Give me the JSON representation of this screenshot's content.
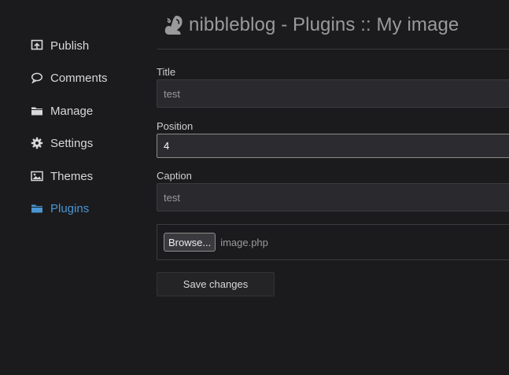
{
  "header": {
    "logo_icon": "squirrel-logo-icon",
    "title": "nibbleblog - Plugins :: My image"
  },
  "sidebar": {
    "items": [
      {
        "label": "Publish",
        "icon": "publish-icon",
        "active": false
      },
      {
        "label": "Comments",
        "icon": "comment-icon",
        "active": false
      },
      {
        "label": "Manage",
        "icon": "folder-icon",
        "active": false
      },
      {
        "label": "Settings",
        "icon": "gear-icon",
        "active": false
      },
      {
        "label": "Themes",
        "icon": "image-icon",
        "active": false
      },
      {
        "label": "Plugins",
        "icon": "folder-icon",
        "active": true
      }
    ]
  },
  "form": {
    "title_label": "Title",
    "title_value": "test",
    "position_label": "Position",
    "position_value": "4",
    "caption_label": "Caption",
    "caption_value": "test",
    "browse_label": "Browse...",
    "file_name": "image.php",
    "save_label": "Save changes"
  },
  "colors": {
    "background": "#1b1b1d",
    "active_nav": "#4a95d2",
    "text": "#d8d8d8",
    "muted_text": "#9a9a9a"
  }
}
